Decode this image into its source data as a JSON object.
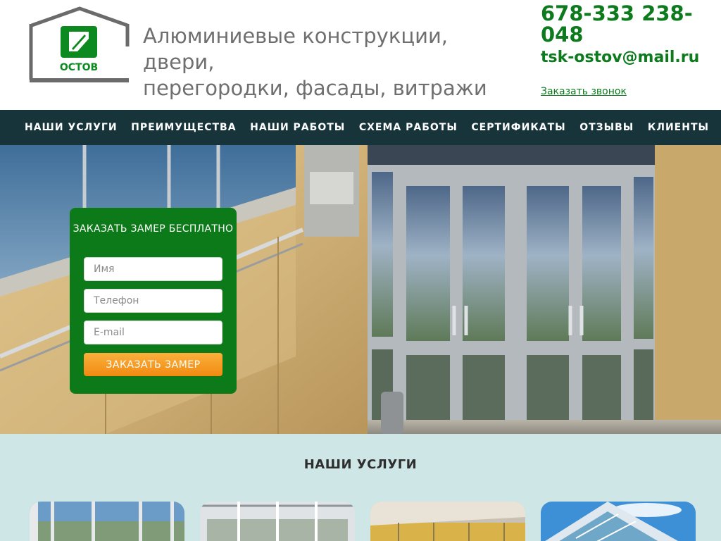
{
  "header": {
    "logo_text": "ОСТОВ",
    "tagline_line1": "Алюминиевые конструкции, двери,",
    "tagline_line2": "перегородки, фасады, витражи",
    "phone": "678-333 238-048",
    "email": "tsk-ostov@mail.ru",
    "callback_label": "Заказать звонок"
  },
  "nav": {
    "items": [
      {
        "label": "НАШИ УСЛУГИ"
      },
      {
        "label": "ПРЕИМУЩЕСТВА"
      },
      {
        "label": "НАШИ РАБОТЫ"
      },
      {
        "label": "СХЕМА РАБОТЫ"
      },
      {
        "label": "СЕРТИФИКАТЫ"
      },
      {
        "label": "ОТЗЫВЫ"
      },
      {
        "label": "КЛИЕНТЫ"
      }
    ]
  },
  "form": {
    "title": "ЗАКАЗАТЬ ЗАМЕР БЕСПЛАТНО",
    "name_placeholder": "Имя",
    "phone_placeholder": "Телефон",
    "email_placeholder": "E-mail",
    "submit_label": "ЗАКАЗАТЬ ЗАМЕР"
  },
  "services": {
    "title": "НАШИ УСЛУГИ"
  },
  "colors": {
    "brand_green": "#0c7a1d",
    "nav_bg": "#16343a",
    "button_orange": "#f7a12a",
    "services_bg": "#cfe6e7"
  }
}
